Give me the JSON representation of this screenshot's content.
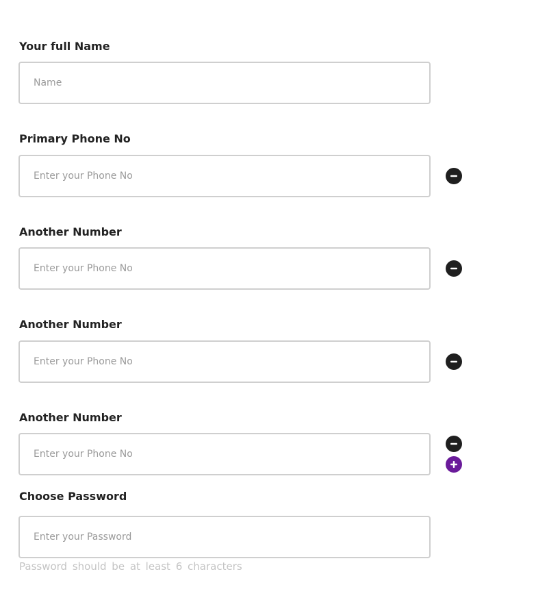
{
  "form": {
    "name": {
      "label": "Your full Name",
      "placeholder": "Name",
      "value": ""
    },
    "primary_phone": {
      "label": "Primary Phone No",
      "placeholder": "Enter your Phone No",
      "value": ""
    },
    "extra_phones": [
      {
        "label": "Another Number",
        "placeholder": "Enter your Phone No",
        "value": ""
      },
      {
        "label": "Another Number",
        "placeholder": "Enter your Phone No",
        "value": ""
      },
      {
        "label": "Another Number",
        "placeholder": "Enter your Phone No",
        "value": ""
      }
    ],
    "password": {
      "label": "Choose Password",
      "placeholder": "Enter your Password",
      "value": "",
      "hint": "Password should be at least 6 characters"
    }
  },
  "icons": {
    "remove": "minus-circle-icon",
    "add": "plus-circle-icon"
  },
  "colors": {
    "remove_button": "#1f1f1f",
    "add_button": "#6a1b9a",
    "input_border": "#cfcfcf",
    "hint_text": "#c4c4c4"
  }
}
